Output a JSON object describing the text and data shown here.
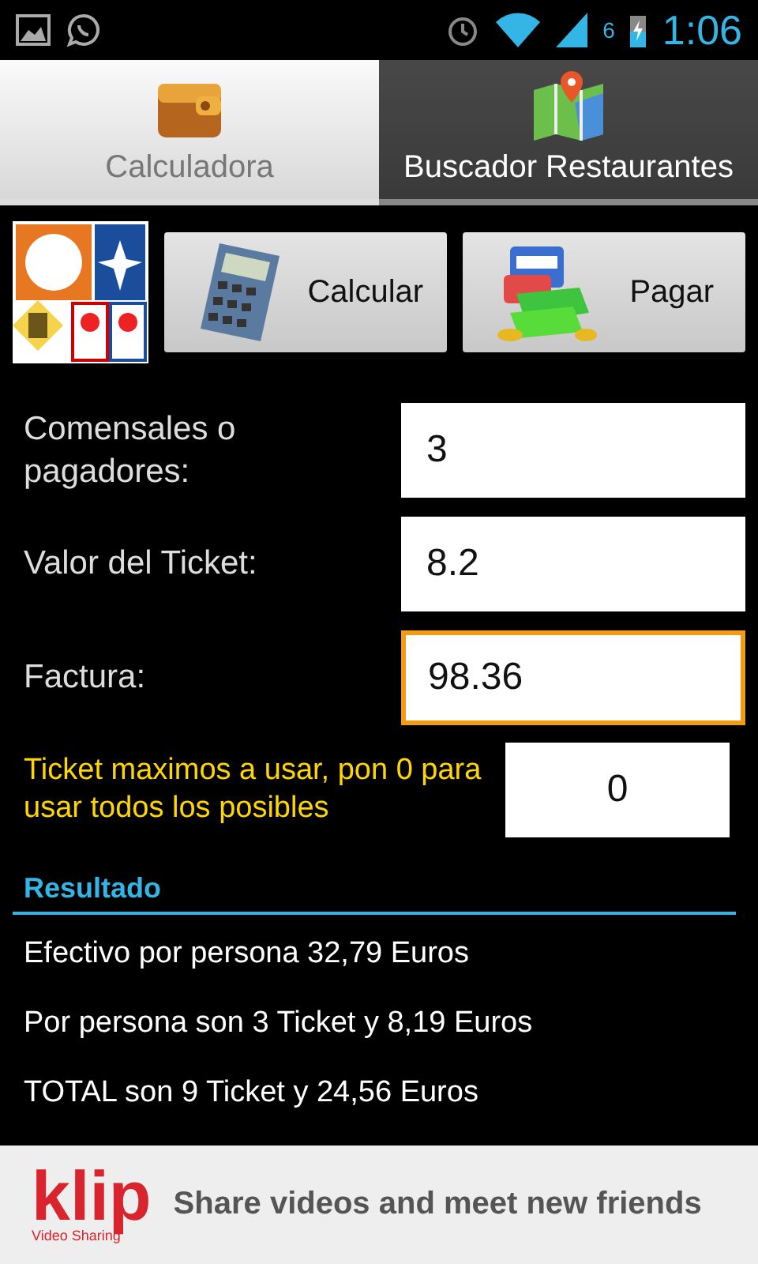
{
  "status_bar": {
    "notification_count": "6",
    "time": "1:06"
  },
  "tabs": [
    {
      "label": "Calculadora",
      "selected": true
    },
    {
      "label": "Buscador Restaurantes",
      "selected": false
    }
  ],
  "actions": [
    {
      "label": "Calcular"
    },
    {
      "label": "Pagar"
    }
  ],
  "fields": [
    {
      "label": "Comensales o pagadores:",
      "value": "3",
      "focused": false
    },
    {
      "label": "Valor del Ticket:",
      "value": "8.2",
      "focused": false
    },
    {
      "label": "Factura:",
      "value": "98.36",
      "focused": true
    }
  ],
  "max_tickets": {
    "label": "Ticket maximos a usar, pon 0 para usar todos los posibles",
    "value": "0"
  },
  "result": {
    "heading": "Resultado",
    "lines": [
      "Efectivo por persona 32,79 Euros",
      "Por persona son 3 Ticket y 8,19 Euros",
      "TOTAL son 9 Ticket y 24,56 Euros"
    ]
  },
  "ad": {
    "brand": "klip",
    "subtitle": "Video Sharing",
    "slogan": "Share videos and meet new friends"
  }
}
